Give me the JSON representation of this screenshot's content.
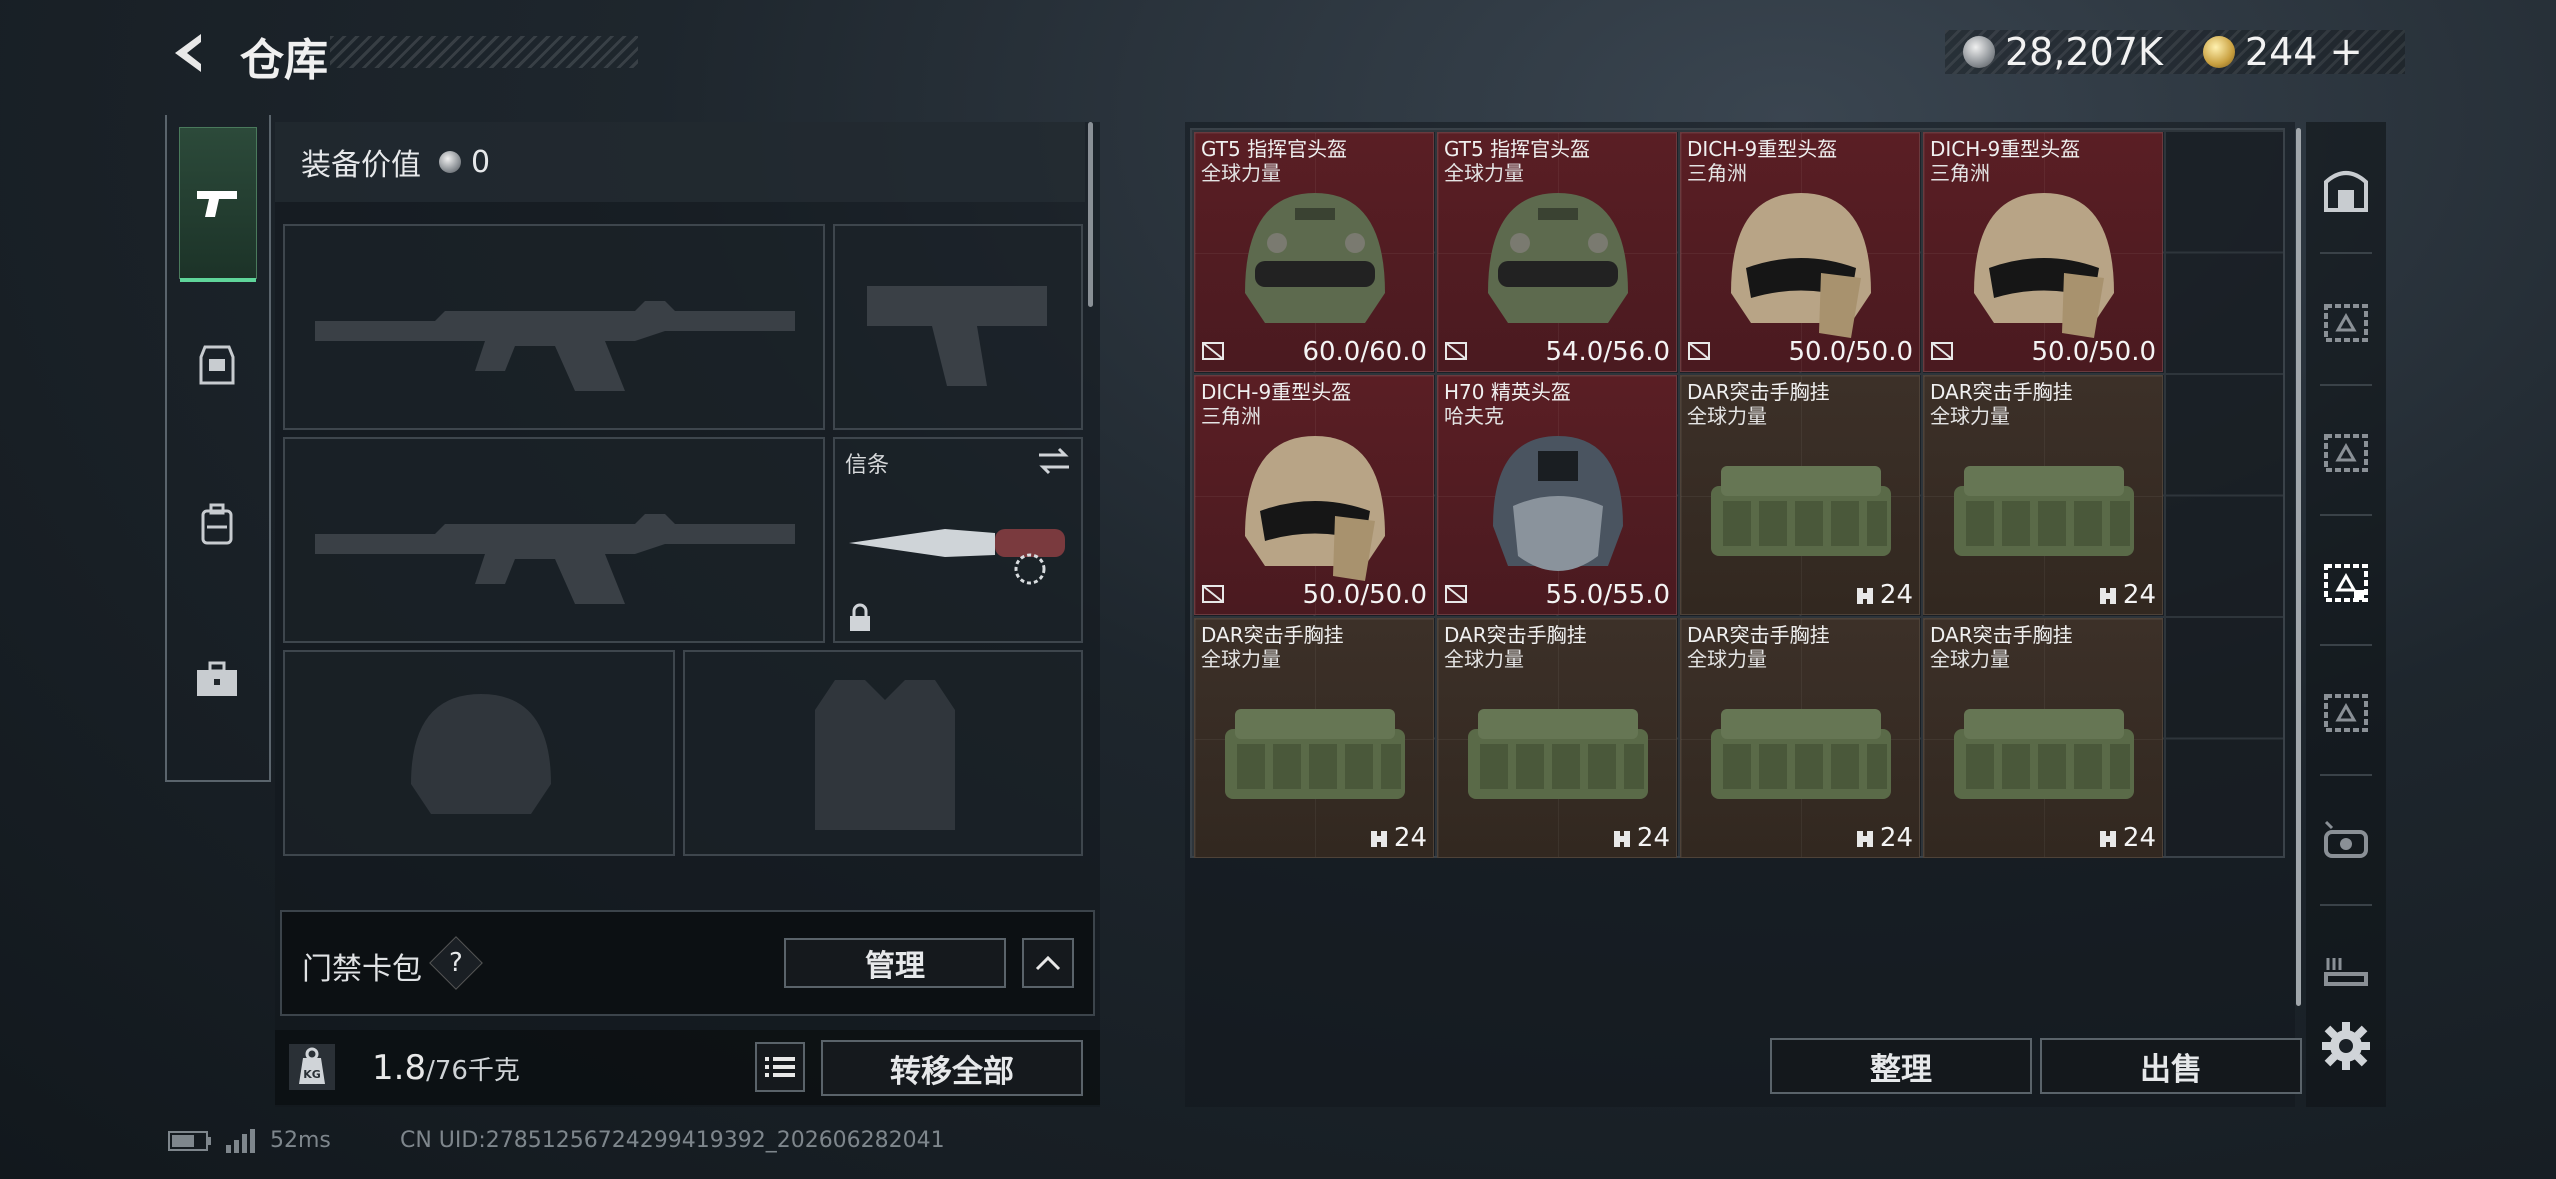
{
  "header": {
    "title": "仓库",
    "currency_silver": "28,207K",
    "currency_gold": "244",
    "plus_label": "+"
  },
  "left_panel": {
    "equip_value_label": "装备价值",
    "equip_value": "0",
    "melee_slot_label": "信条",
    "keycard_label": "门禁卡包",
    "keycard_help": "?",
    "manage_label": "管理",
    "weight_current": "1.8",
    "weight_max": "/76千克",
    "weight_icon_text": "KG",
    "transfer_all_label": "转移全部"
  },
  "inventory": {
    "items": [
      {
        "name": "GT5 指挥官头盔",
        "sub": "全球力量",
        "stat": "60.0/60.0",
        "kind": "helmet-gt5",
        "tone": "red"
      },
      {
        "name": "GT5 指挥官头盔",
        "sub": "全球力量",
        "stat": "54.0/56.0",
        "kind": "helmet-gt5",
        "tone": "red"
      },
      {
        "name": "DICH-9重型头盔",
        "sub": "三角洲",
        "stat": "50.0/50.0",
        "kind": "helmet-dich",
        "tone": "red"
      },
      {
        "name": "DICH-9重型头盔",
        "sub": "三角洲",
        "stat": "50.0/50.0",
        "kind": "helmet-dich",
        "tone": "red"
      },
      {
        "name": "DICH-9重型头盔",
        "sub": "三角洲",
        "stat": "50.0/50.0",
        "kind": "helmet-dich",
        "tone": "red"
      },
      {
        "name": "H70 精英头盔",
        "sub": "哈夫克",
        "stat": "55.0/55.0",
        "kind": "helmet-h70",
        "tone": "red"
      },
      {
        "name": "DAR突击手胸挂",
        "sub": "全球力量",
        "stat": "24",
        "kind": "rig",
        "tone": "brown"
      },
      {
        "name": "DAR突击手胸挂",
        "sub": "全球力量",
        "stat": "24",
        "kind": "rig",
        "tone": "brown"
      },
      {
        "name": "DAR突击手胸挂",
        "sub": "全球力量",
        "stat": "24",
        "kind": "rig",
        "tone": "brown"
      },
      {
        "name": "DAR突击手胸挂",
        "sub": "全球力量",
        "stat": "24",
        "kind": "rig",
        "tone": "brown"
      },
      {
        "name": "DAR突击手胸挂",
        "sub": "全球力量",
        "stat": "24",
        "kind": "rig",
        "tone": "brown"
      },
      {
        "name": "DAR突击手胸挂",
        "sub": "全球力量",
        "stat": "24",
        "kind": "rig",
        "tone": "brown"
      }
    ],
    "sort_label": "整理",
    "sell_label": "出售"
  },
  "status_bar": {
    "ping": "52ms",
    "uid": "CN UID:2785125672429941939​2_202606282041"
  },
  "icons": {
    "back": "back-arrow-icon",
    "rail": [
      "pistol-icon",
      "armor-icon",
      "backpack-icon",
      "toolbox-icon"
    ],
    "right_rail": [
      "vault-icon",
      "case-1-icon",
      "case-2-icon",
      "case-3-icon",
      "case-4-icon",
      "case-5-icon",
      "case-6-icon",
      "settings-icon"
    ]
  },
  "colors": {
    "accent_green": "#5fd59a",
    "item_red": "#5a1e24",
    "item_brown": "#3c3028"
  }
}
